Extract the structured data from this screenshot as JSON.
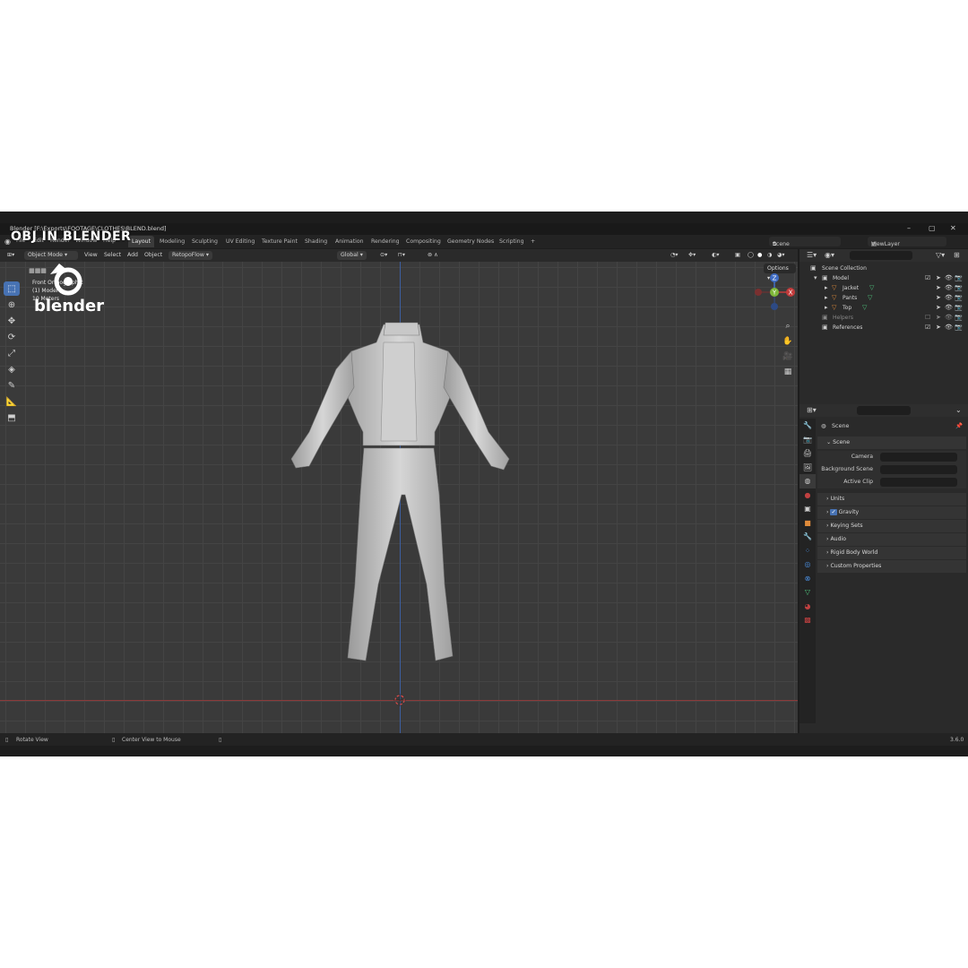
{
  "watermark": {
    "title": "OBJ IN BLENDER",
    "logo_text": "blender"
  },
  "window": {
    "title": "Blender [F:\\Exports\\FOOTAGE\\CLOTHES\\BLEND.blend]"
  },
  "menu": [
    "File",
    "Edit",
    "Render",
    "Window",
    "Help"
  ],
  "workspaces": [
    "Layout",
    "Modeling",
    "Sculpting",
    "UV Editing",
    "Texture Paint",
    "Shading",
    "Animation",
    "Rendering",
    "Compositing",
    "Geometry Nodes",
    "Scripting",
    "+"
  ],
  "top_right": {
    "scene": "Scene",
    "view_layer": "ViewLayer"
  },
  "viewport_header": {
    "mode": "Object Mode",
    "menus": [
      "View",
      "Select",
      "Add",
      "Object"
    ],
    "retopo": "RetopoFlow",
    "transform": "Global",
    "options": "Options"
  },
  "viewport": {
    "overlay_lines": [
      "Front Orthographic",
      "(1) Model",
      "10 Meters"
    ]
  },
  "gizmo": {
    "x": "X",
    "y": "Y",
    "z": "Z"
  },
  "outliner": {
    "items": [
      {
        "label": "Scene Collection"
      },
      {
        "label": "Model"
      },
      {
        "label": "Jacket"
      },
      {
        "label": "Pants"
      },
      {
        "label": "Top"
      },
      {
        "label": "Helpers"
      },
      {
        "label": "References"
      }
    ]
  },
  "properties": {
    "header": "Scene",
    "panel_scene": "Scene",
    "fields": [
      {
        "label": "Camera"
      },
      {
        "label": "Background Scene"
      },
      {
        "label": "Active Clip"
      }
    ],
    "panels": [
      "Units",
      "Gravity",
      "Keying Sets",
      "Audio",
      "Rigid Body World",
      "Custom Properties"
    ]
  },
  "status": {
    "left": "Rotate View",
    "mid": "Center View to Mouse",
    "version": "3.6.0"
  },
  "colors": {
    "accent": "#4772b3",
    "viewport_bg": "#3a3a3a",
    "x_axis": "#c23b3b",
    "y_axis": "#7fb83a",
    "z_axis": "#3f6cc4"
  }
}
